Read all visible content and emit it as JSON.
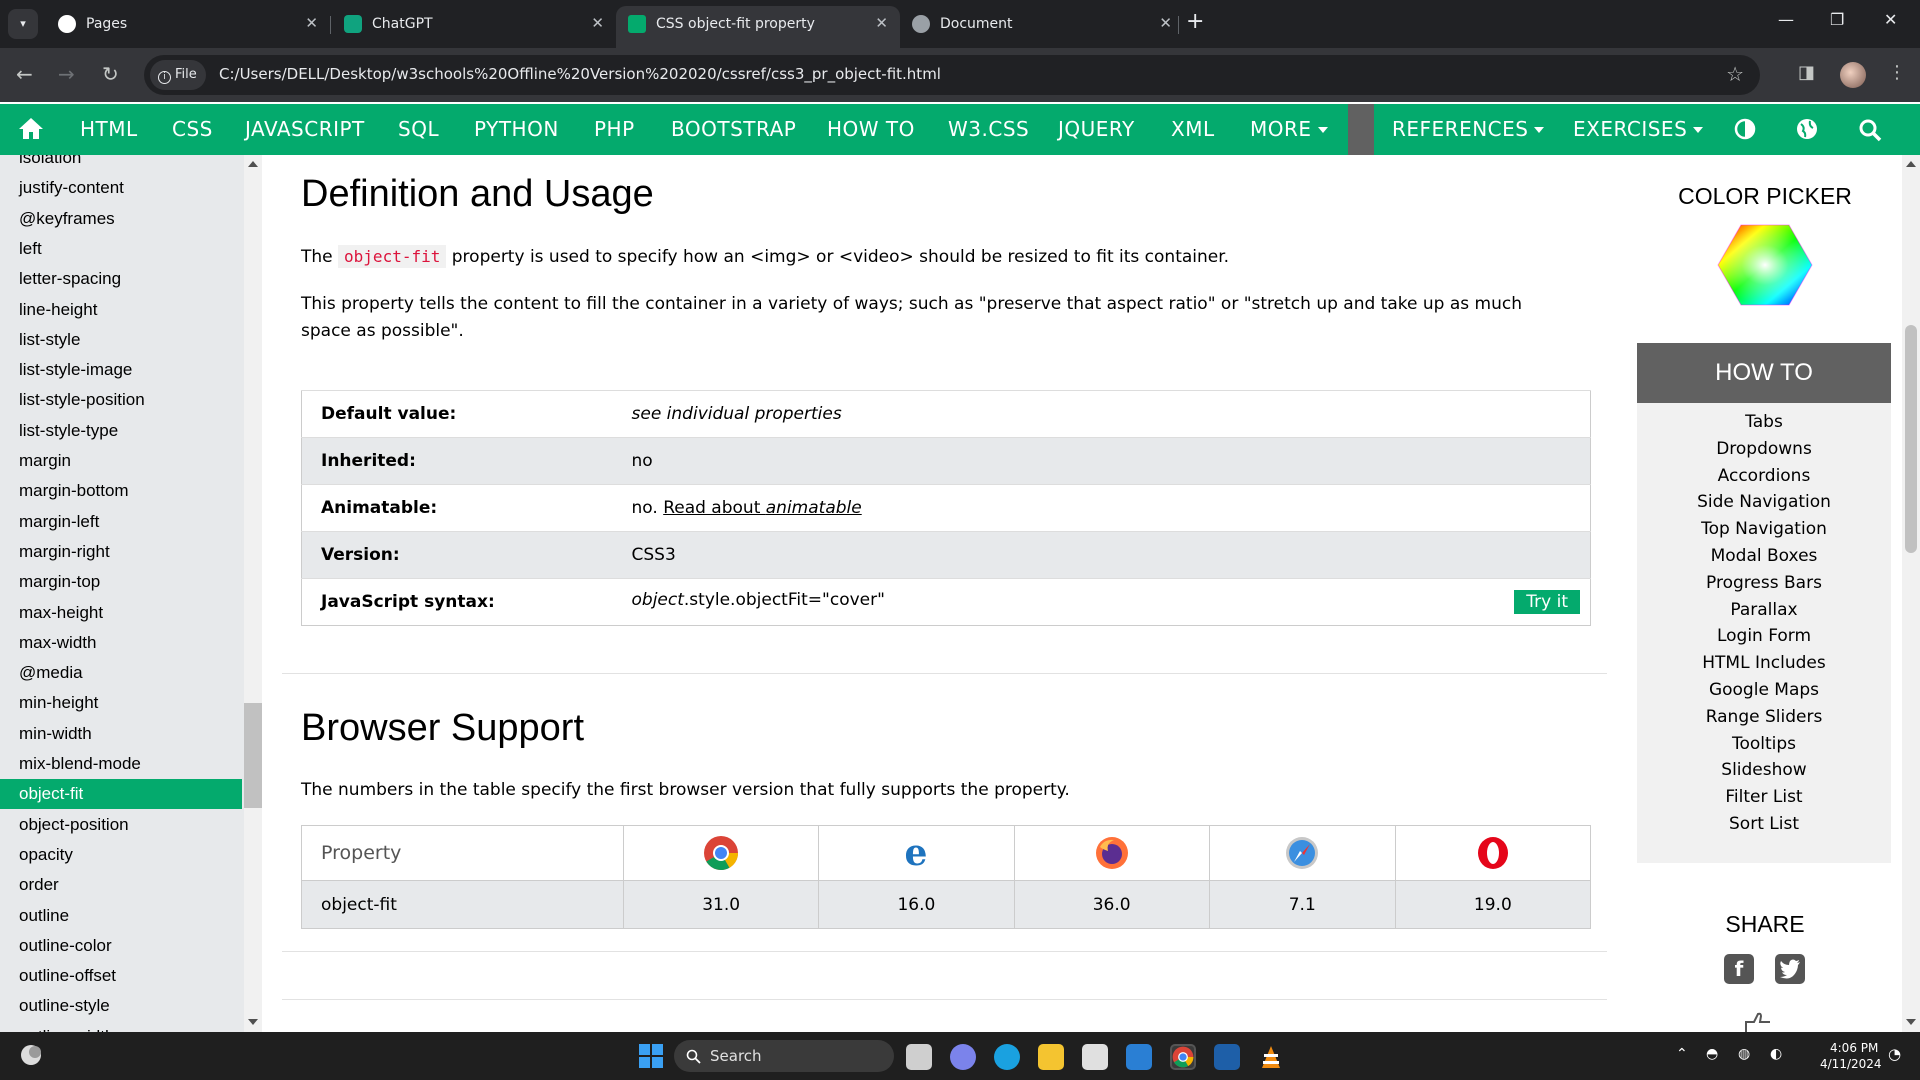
{
  "browser": {
    "tabs": [
      {
        "title": "Pages",
        "icon": "github-icon"
      },
      {
        "title": "ChatGPT",
        "icon": "chatgpt-icon"
      },
      {
        "title": "CSS object-fit property",
        "icon": "w3schools-icon",
        "active": true
      },
      {
        "title": "Document",
        "icon": "globe-icon"
      }
    ],
    "url_chip": "File",
    "url": "C:/Users/DELL/Desktop/w3schools%20Offline%20Version%202020/cssref/css3_pr_object-fit.html"
  },
  "topnav": {
    "items": [
      "HTML",
      "CSS",
      "JAVASCRIPT",
      "SQL",
      "PYTHON",
      "PHP",
      "BOOTSTRAP",
      "HOW TO",
      "W3.CSS",
      "JQUERY",
      "XML",
      "MORE"
    ],
    "right_items": [
      "REFERENCES",
      "EXERCISES"
    ]
  },
  "sidebar": {
    "items": [
      "isolation",
      "justify-content",
      "@keyframes",
      "left",
      "letter-spacing",
      "line-height",
      "list-style",
      "list-style-image",
      "list-style-position",
      "list-style-type",
      "margin",
      "margin-bottom",
      "margin-left",
      "margin-right",
      "margin-top",
      "max-height",
      "max-width",
      "@media",
      "min-height",
      "min-width",
      "mix-blend-mode",
      "object-fit",
      "object-position",
      "opacity",
      "order",
      "outline",
      "outline-color",
      "outline-offset",
      "outline-style",
      "outline-width"
    ],
    "active": "object-fit"
  },
  "main": {
    "definition": {
      "heading": "Definition and Usage",
      "p1_pre": "The ",
      "p1_code": "object-fit",
      "p1_post": " property is used to specify how an <img> or <video> should be resized to fit its container.",
      "p2": "This property tells the content to fill the container in a variety of ways; such as \"preserve that aspect ratio\" or \"stretch up and take up as much space as possible\"."
    },
    "props": {
      "default_label": "Default value:",
      "default_value": "see individual properties",
      "inherited_label": "Inherited:",
      "inherited_value": "no",
      "animatable_label": "Animatable:",
      "animatable_pre": "no. ",
      "animatable_link_a": "Read about ",
      "animatable_link_b": "animatable",
      "version_label": "Version:",
      "version_value": "CSS3",
      "js_label": "JavaScript syntax:",
      "js_obj": "object",
      "js_rest": ".style.objectFit=\"cover\"",
      "try_it": "Try it"
    },
    "browser_support": {
      "heading": "Browser Support",
      "desc": "The numbers in the table specify the first browser version that fully supports the property.",
      "header_label": "Property",
      "browsers": [
        "chrome-icon",
        "edge-icon",
        "firefox-icon",
        "safari-icon",
        "opera-icon"
      ],
      "row_label": "object-fit",
      "versions": [
        "31.0",
        "16.0",
        "36.0",
        "7.1",
        "19.0"
      ]
    }
  },
  "rightbar": {
    "color_picker": "COLOR PICKER",
    "howto_title": "HOW TO",
    "howto_links": [
      "Tabs",
      "Dropdowns",
      "Accordions",
      "Side Navigation",
      "Top Navigation",
      "Modal Boxes",
      "Progress Bars",
      "Parallax",
      "Login Form",
      "HTML Includes",
      "Google Maps",
      "Range Sliders",
      "Tooltips",
      "Slideshow",
      "Filter List",
      "Sort List"
    ],
    "share": "SHARE"
  },
  "taskbar": {
    "search": "Search",
    "time": "4:06 PM",
    "date": "4/11/2024"
  },
  "colors": {
    "accent": "#04aa6d",
    "code": "#dc143c",
    "howto_header": "#616161"
  }
}
